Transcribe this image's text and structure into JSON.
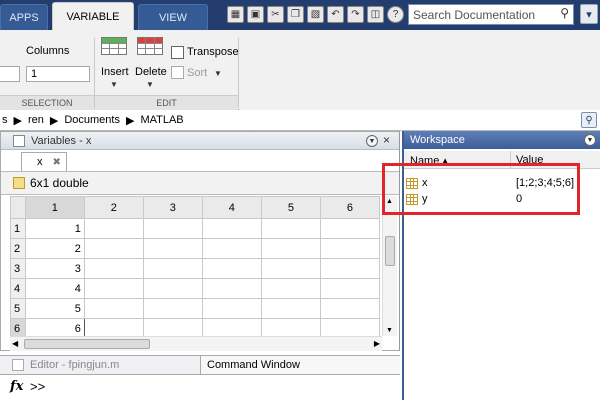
{
  "tabs": [
    {
      "label": "APPS"
    },
    {
      "label": "VARIABLE"
    },
    {
      "label": "VIEW"
    }
  ],
  "search": {
    "placeholder": "Search Documentation"
  },
  "ribbon": {
    "columns_label": "Columns",
    "columns_value": "1",
    "insert_label": "Insert",
    "delete_label": "Delete",
    "transpose_label": "Transpose",
    "sort_label": "Sort",
    "section_selection": "SELECTION",
    "section_edit": "EDIT"
  },
  "address": {
    "parts": [
      "s",
      "ren",
      "Documents",
      "MATLAB"
    ]
  },
  "variables": {
    "title": "Variables - x",
    "tab": "x",
    "description": "6x1 double",
    "col_headers": [
      "1",
      "2",
      "3",
      "4",
      "5",
      "6"
    ],
    "rows": [
      {
        "n": "1",
        "v": "1"
      },
      {
        "n": "2",
        "v": "2"
      },
      {
        "n": "3",
        "v": "3"
      },
      {
        "n": "4",
        "v": "4"
      },
      {
        "n": "5",
        "v": "5"
      },
      {
        "n": "6",
        "v": "6"
      }
    ]
  },
  "bottom": {
    "editor": "Editor - fpingjun.m",
    "command": "Command Window"
  },
  "command": {
    "fx": "fx",
    "prompt": ">>"
  },
  "workspace": {
    "title": "Workspace",
    "col_name": "Name ▴",
    "col_value": "Value",
    "items": [
      {
        "name": "x",
        "value": "[1;2;3;4;5;6]"
      },
      {
        "name": "y",
        "value": "0"
      }
    ]
  },
  "colors": {
    "highlight": "#e0262a",
    "titlebar": "#233e6e"
  }
}
